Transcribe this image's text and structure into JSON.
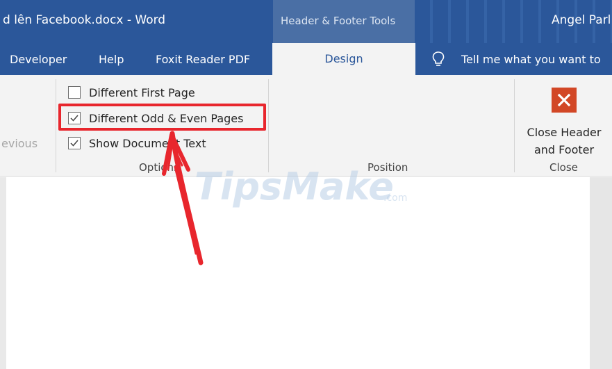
{
  "titlebar": {
    "document_title": "d lên Facebook.docx  -  Word",
    "contextual_tools_label": "Header & Footer Tools",
    "user_name": "Angel Parl"
  },
  "tabs": {
    "developer": "Developer",
    "help": "Help",
    "foxit": "Foxit Reader PDF",
    "design": "Design",
    "tell_me": "Tell me what you want to"
  },
  "ribbon": {
    "previous_fragment": "evious",
    "options": {
      "different_first_page": {
        "label": "Different First Page",
        "checked": false
      },
      "different_odd_even": {
        "label": "Different Odd & Even Pages",
        "checked": true
      },
      "show_document_text": {
        "label": "Show Document Text",
        "checked": true
      },
      "group_label": "Options"
    },
    "position": {
      "group_label": "Position"
    },
    "close": {
      "button_label_line1": "Close Header",
      "button_label_line2": "and Footer",
      "group_label": "Close"
    }
  },
  "annotation": {
    "highlight_color": "#e8262d",
    "arrow_color": "#e8262d"
  },
  "watermark": {
    "brand": "TipsMake",
    "suffix": ".com"
  },
  "colors": {
    "word_blue": "#2b579a",
    "ribbon_bg": "#f3f3f3",
    "close_red": "#d24726"
  }
}
